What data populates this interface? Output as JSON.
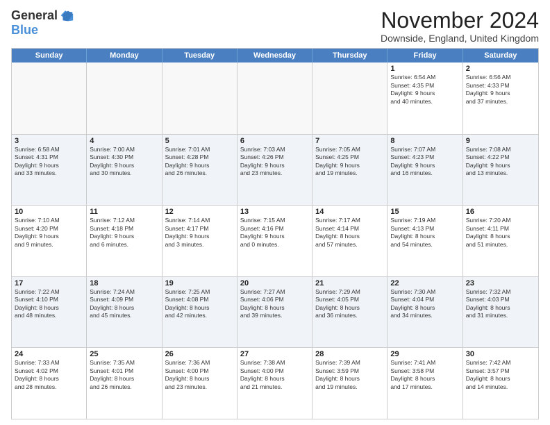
{
  "header": {
    "logo_general": "General",
    "logo_blue": "Blue",
    "month_title": "November 2024",
    "location": "Downside, England, United Kingdom"
  },
  "days_of_week": [
    "Sunday",
    "Monday",
    "Tuesday",
    "Wednesday",
    "Thursday",
    "Friday",
    "Saturday"
  ],
  "weeks": [
    [
      {
        "day": "",
        "info": ""
      },
      {
        "day": "",
        "info": ""
      },
      {
        "day": "",
        "info": ""
      },
      {
        "day": "",
        "info": ""
      },
      {
        "day": "",
        "info": ""
      },
      {
        "day": "1",
        "info": "Sunrise: 6:54 AM\nSunset: 4:35 PM\nDaylight: 9 hours\nand 40 minutes."
      },
      {
        "day": "2",
        "info": "Sunrise: 6:56 AM\nSunset: 4:33 PM\nDaylight: 9 hours\nand 37 minutes."
      }
    ],
    [
      {
        "day": "3",
        "info": "Sunrise: 6:58 AM\nSunset: 4:31 PM\nDaylight: 9 hours\nand 33 minutes."
      },
      {
        "day": "4",
        "info": "Sunrise: 7:00 AM\nSunset: 4:30 PM\nDaylight: 9 hours\nand 30 minutes."
      },
      {
        "day": "5",
        "info": "Sunrise: 7:01 AM\nSunset: 4:28 PM\nDaylight: 9 hours\nand 26 minutes."
      },
      {
        "day": "6",
        "info": "Sunrise: 7:03 AM\nSunset: 4:26 PM\nDaylight: 9 hours\nand 23 minutes."
      },
      {
        "day": "7",
        "info": "Sunrise: 7:05 AM\nSunset: 4:25 PM\nDaylight: 9 hours\nand 19 minutes."
      },
      {
        "day": "8",
        "info": "Sunrise: 7:07 AM\nSunset: 4:23 PM\nDaylight: 9 hours\nand 16 minutes."
      },
      {
        "day": "9",
        "info": "Sunrise: 7:08 AM\nSunset: 4:22 PM\nDaylight: 9 hours\nand 13 minutes."
      }
    ],
    [
      {
        "day": "10",
        "info": "Sunrise: 7:10 AM\nSunset: 4:20 PM\nDaylight: 9 hours\nand 9 minutes."
      },
      {
        "day": "11",
        "info": "Sunrise: 7:12 AM\nSunset: 4:18 PM\nDaylight: 9 hours\nand 6 minutes."
      },
      {
        "day": "12",
        "info": "Sunrise: 7:14 AM\nSunset: 4:17 PM\nDaylight: 9 hours\nand 3 minutes."
      },
      {
        "day": "13",
        "info": "Sunrise: 7:15 AM\nSunset: 4:16 PM\nDaylight: 9 hours\nand 0 minutes."
      },
      {
        "day": "14",
        "info": "Sunrise: 7:17 AM\nSunset: 4:14 PM\nDaylight: 8 hours\nand 57 minutes."
      },
      {
        "day": "15",
        "info": "Sunrise: 7:19 AM\nSunset: 4:13 PM\nDaylight: 8 hours\nand 54 minutes."
      },
      {
        "day": "16",
        "info": "Sunrise: 7:20 AM\nSunset: 4:11 PM\nDaylight: 8 hours\nand 51 minutes."
      }
    ],
    [
      {
        "day": "17",
        "info": "Sunrise: 7:22 AM\nSunset: 4:10 PM\nDaylight: 8 hours\nand 48 minutes."
      },
      {
        "day": "18",
        "info": "Sunrise: 7:24 AM\nSunset: 4:09 PM\nDaylight: 8 hours\nand 45 minutes."
      },
      {
        "day": "19",
        "info": "Sunrise: 7:25 AM\nSunset: 4:08 PM\nDaylight: 8 hours\nand 42 minutes."
      },
      {
        "day": "20",
        "info": "Sunrise: 7:27 AM\nSunset: 4:06 PM\nDaylight: 8 hours\nand 39 minutes."
      },
      {
        "day": "21",
        "info": "Sunrise: 7:29 AM\nSunset: 4:05 PM\nDaylight: 8 hours\nand 36 minutes."
      },
      {
        "day": "22",
        "info": "Sunrise: 7:30 AM\nSunset: 4:04 PM\nDaylight: 8 hours\nand 34 minutes."
      },
      {
        "day": "23",
        "info": "Sunrise: 7:32 AM\nSunset: 4:03 PM\nDaylight: 8 hours\nand 31 minutes."
      }
    ],
    [
      {
        "day": "24",
        "info": "Sunrise: 7:33 AM\nSunset: 4:02 PM\nDaylight: 8 hours\nand 28 minutes."
      },
      {
        "day": "25",
        "info": "Sunrise: 7:35 AM\nSunset: 4:01 PM\nDaylight: 8 hours\nand 26 minutes."
      },
      {
        "day": "26",
        "info": "Sunrise: 7:36 AM\nSunset: 4:00 PM\nDaylight: 8 hours\nand 23 minutes."
      },
      {
        "day": "27",
        "info": "Sunrise: 7:38 AM\nSunset: 4:00 PM\nDaylight: 8 hours\nand 21 minutes."
      },
      {
        "day": "28",
        "info": "Sunrise: 7:39 AM\nSunset: 3:59 PM\nDaylight: 8 hours\nand 19 minutes."
      },
      {
        "day": "29",
        "info": "Sunrise: 7:41 AM\nSunset: 3:58 PM\nDaylight: 8 hours\nand 17 minutes."
      },
      {
        "day": "30",
        "info": "Sunrise: 7:42 AM\nSunset: 3:57 PM\nDaylight: 8 hours\nand 14 minutes."
      }
    ]
  ]
}
